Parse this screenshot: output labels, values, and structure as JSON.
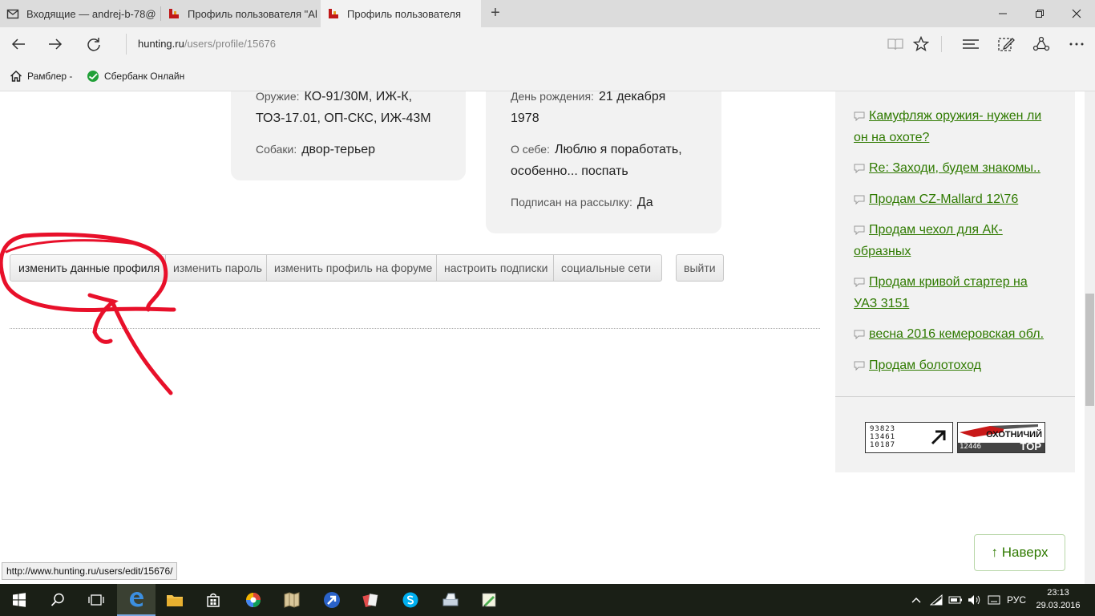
{
  "browser": {
    "tabs": [
      {
        "title": "Входящие — andrej-b-78@",
        "icon": "mail-icon"
      },
      {
        "title": "Профиль пользователя \"Al",
        "icon": "hunting-site-icon"
      },
      {
        "title": "Профиль пользователя",
        "icon": "hunting-site-icon"
      }
    ],
    "new_tab": "+",
    "address": {
      "domain": "hunting.ru",
      "path": "/users/profile/15676"
    },
    "favorites": [
      {
        "label": "Рамблер -",
        "icon": "home-icon"
      },
      {
        "label": "Сбербанк Онлайн",
        "icon": "sberbank-icon"
      }
    ]
  },
  "profile": {
    "weapons_label": "Оружие:",
    "weapons_value": "КО-91/30М, ИЖ-К,",
    "weapons_value_line2": "ТОЗ-17.01, ОП-СКС, ИЖ-43М",
    "dogs_label": "Собаки:",
    "dogs_value": "двор-терьер",
    "birthday_label": "День рождения:",
    "birthday_value": "21 декабря",
    "birthday_value_line2": "1978",
    "about_label": "О себе:",
    "about_value": "Люблю я поработать,",
    "about_value_line2": "особенно... поспать",
    "subscribed_label": "Подписан на рассылку:",
    "subscribed_value": "Да"
  },
  "actions": {
    "buttons": [
      "изменить данные профиля",
      "изменить пароль",
      "изменить профиль на форуме",
      "настроить подписки",
      "социальные сети"
    ],
    "logout": "выйти"
  },
  "sidebar": {
    "links": [
      {
        "line1": "Камуфляж оружия- нужен ли",
        "line2": "он на охоте?"
      },
      {
        "line1": "Re: Заходи, будем знакомы..",
        "line2": ""
      },
      {
        "line1": "Продам CZ-Mallard 12\\76",
        "line2": ""
      },
      {
        "line1": "Продам чехол для АК-",
        "line2": "образных"
      },
      {
        "line1": "Продам кривой стартер на",
        "line2": "УАЗ 3151"
      },
      {
        "line1": "весна 2016 кемеровская обл.",
        "line2": ""
      },
      {
        "line1": "Продам болотоход",
        "line2": ""
      }
    ],
    "counter1": {
      "line1": "93823",
      "line2": "13461",
      "line3": "10187"
    },
    "counter2": {
      "title": "ОХОТНИЧИЙ",
      "number": "12446",
      "label": "TOP"
    }
  },
  "to_top": "↑ Наверх",
  "status_url": "http://www.hunting.ru/users/edit/15676/",
  "taskbar": {
    "language": "РУС",
    "time": "23:13",
    "date": "29.03.2016"
  },
  "colors": {
    "link_green": "#2f7a00",
    "annotation_red": "#e8102a"
  }
}
